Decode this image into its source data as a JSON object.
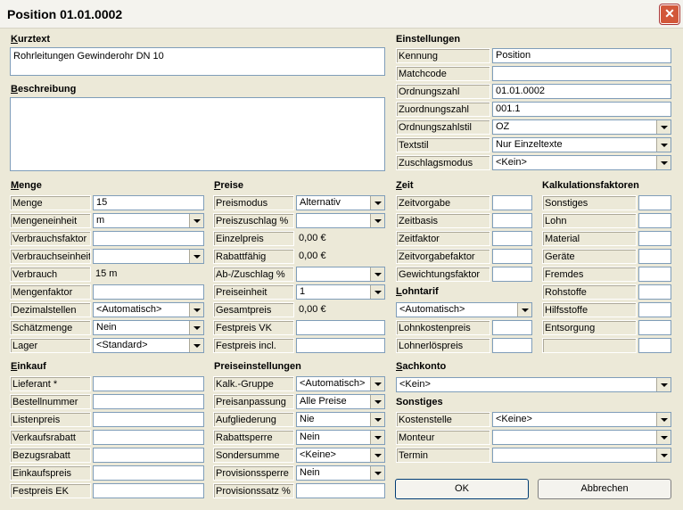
{
  "window": {
    "title": "Position 01.01.0002",
    "close": "✕"
  },
  "kurztext": {
    "header": "Kurztext",
    "value": "Rohrleitungen Gewinderohr DN 10"
  },
  "beschreibung": {
    "header": "Beschreibung",
    "value": ""
  },
  "einstellungen": {
    "header": "Einstellungen",
    "rows": [
      {
        "label": "Kennung",
        "value": "Position"
      },
      {
        "label": "Matchcode",
        "value": ""
      },
      {
        "label": "Ordnungszahl",
        "value": "01.01.0002"
      },
      {
        "label": "Zuordnungszahl",
        "value": "001.1"
      },
      {
        "label": "Ordnungszahlstil",
        "value": "OZ"
      },
      {
        "label": "Textstil",
        "value": "Nur Einzeltexte"
      },
      {
        "label": "Zuschlagsmodus",
        "value": "<Kein>"
      }
    ]
  },
  "menge": {
    "header": "Menge",
    "rows": [
      {
        "label": "Menge",
        "value": "15"
      },
      {
        "label": "Mengeneinheit",
        "value": "m"
      },
      {
        "label": "Verbrauchsfaktor",
        "value": ""
      },
      {
        "label": "Verbrauchseinheit",
        "value": ""
      },
      {
        "label": "Verbrauch",
        "value": "15 m"
      },
      {
        "label": "Mengenfaktor",
        "value": ""
      },
      {
        "label": "Dezimalstellen",
        "value": "<Automatisch>"
      },
      {
        "label": "Schätzmenge",
        "value": "Nein"
      },
      {
        "label": "Lager",
        "value": "<Standard>"
      }
    ]
  },
  "preise": {
    "header": "Preise",
    "rows": [
      {
        "label": "Preismodus",
        "value": "Alternativ"
      },
      {
        "label": "Preiszuschlag %",
        "value": ""
      },
      {
        "label": "Einzelpreis",
        "value": "0,00 €"
      },
      {
        "label": "Rabattfähig",
        "value": "0,00 €"
      },
      {
        "label": "Ab-/Zuschlag %",
        "value": ""
      },
      {
        "label": "Preiseinheit",
        "value": "1"
      },
      {
        "label": "Gesamtpreis",
        "value": "0,00 €"
      },
      {
        "label": "Festpreis VK",
        "value": ""
      },
      {
        "label": "Festpreis incl.",
        "value": ""
      }
    ]
  },
  "zeit": {
    "header": "Zeit",
    "rows": [
      {
        "label": "Zeitvorgabe",
        "value": ""
      },
      {
        "label": "Zeitbasis",
        "value": ""
      },
      {
        "label": "Zeitfaktor",
        "value": ""
      },
      {
        "label": "Zeitvorgabefaktor",
        "value": ""
      },
      {
        "label": "Gewichtungsfaktor",
        "value": ""
      }
    ]
  },
  "lohntarif": {
    "header": "Lohntarif",
    "select": "<Automatisch>",
    "rows": [
      {
        "label": "Lohnkostenpreis",
        "value": ""
      },
      {
        "label": "Lohnerlöspreis",
        "value": ""
      }
    ]
  },
  "kalkulation": {
    "header": "Kalkulationsfaktoren",
    "rows": [
      {
        "label": "Sonstiges",
        "value": ""
      },
      {
        "label": "Lohn",
        "value": ""
      },
      {
        "label": "Material",
        "value": ""
      },
      {
        "label": "Geräte",
        "value": ""
      },
      {
        "label": "Fremdes",
        "value": ""
      },
      {
        "label": "Rohstoffe",
        "value": ""
      },
      {
        "label": "Hilfsstoffe",
        "value": ""
      },
      {
        "label": "Entsorgung",
        "value": ""
      },
      {
        "label": "",
        "value": ""
      }
    ]
  },
  "einkauf": {
    "header": "Einkauf",
    "rows": [
      {
        "label": "Lieferant *",
        "value": ""
      },
      {
        "label": "Bestellnummer",
        "value": ""
      },
      {
        "label": "Listenpreis",
        "value": ""
      },
      {
        "label": "Verkaufsrabatt",
        "value": ""
      },
      {
        "label": "Bezugsrabatt",
        "value": ""
      },
      {
        "label": "Einkaufspreis",
        "value": ""
      },
      {
        "label": "Festpreis EK",
        "value": ""
      }
    ]
  },
  "preiseinstellungen": {
    "header": "Preiseinstellungen",
    "rows": [
      {
        "label": "Kalk.-Gruppe",
        "value": "<Automatisch>"
      },
      {
        "label": "Preisanpassung",
        "value": "Alle Preise"
      },
      {
        "label": "Aufgliederung",
        "value": "Nie"
      },
      {
        "label": "Rabattsperre",
        "value": "Nein"
      },
      {
        "label": "Sondersumme",
        "value": "<Keine>"
      },
      {
        "label": "Provisionssperre",
        "value": "Nein"
      },
      {
        "label": "Provisionssatz %",
        "value": ""
      }
    ]
  },
  "sachkonto": {
    "header": "Sachkonto",
    "value": "<Kein>"
  },
  "sonstiges": {
    "header": "Sonstiges",
    "rows": [
      {
        "label": "Kostenstelle",
        "value": "<Keine>"
      },
      {
        "label": "Monteur",
        "value": ""
      },
      {
        "label": "Termin",
        "value": ""
      }
    ]
  },
  "buttons": {
    "ok": "OK",
    "cancel": "Abbrechen"
  }
}
